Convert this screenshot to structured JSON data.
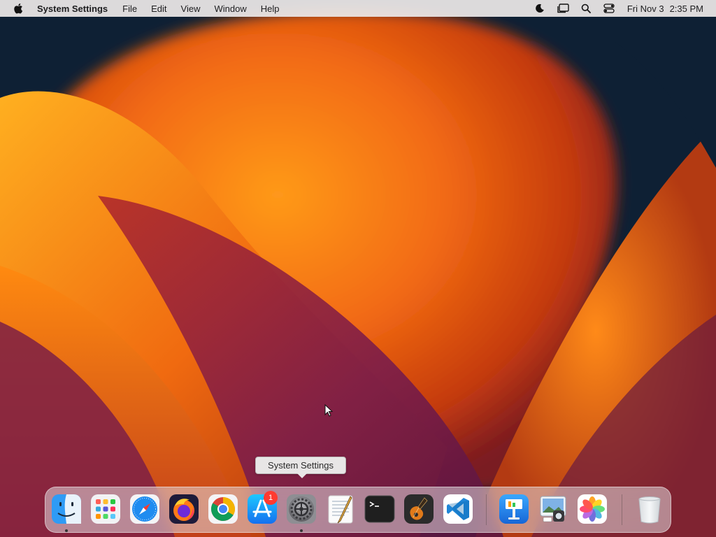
{
  "menubar": {
    "app_name": "System Settings",
    "menus": [
      "File",
      "Edit",
      "View",
      "Window",
      "Help"
    ],
    "status_icons": [
      "focus-moon-icon",
      "stage-manager-icon",
      "spotlight-search-icon",
      "control-center-icon"
    ],
    "clock_day": "Fri Nov 3",
    "clock_time": "2:35 PM"
  },
  "tooltip": {
    "text": "System Settings"
  },
  "dock": {
    "items": [
      {
        "name": "Finder",
        "icon": "finder-icon",
        "running": true
      },
      {
        "name": "Launchpad",
        "icon": "launchpad-icon",
        "running": false
      },
      {
        "name": "Safari",
        "icon": "safari-icon",
        "running": false
      },
      {
        "name": "Firefox",
        "icon": "firefox-icon",
        "running": false
      },
      {
        "name": "Chrome",
        "icon": "chrome-icon",
        "running": false
      },
      {
        "name": "App Store",
        "icon": "app-store-icon",
        "running": false
      },
      {
        "name": "System Settings",
        "icon": "system-settings-icon",
        "running": true,
        "badge": "1"
      },
      {
        "name": "TextEdit",
        "icon": "textedit-icon",
        "running": false
      },
      {
        "name": "Terminal",
        "icon": "terminal-icon",
        "running": false
      },
      {
        "name": "GarageBand",
        "icon": "garageband-icon",
        "running": false
      },
      {
        "name": "Visual Studio Code",
        "icon": "vscode-icon",
        "running": false
      },
      {
        "name": "Keynote",
        "icon": "keynote-icon",
        "running": false
      },
      {
        "name": "Preview",
        "icon": "preview-icon",
        "running": false
      },
      {
        "name": "Photos",
        "icon": "photos-icon",
        "running": false
      },
      {
        "name": "Trash",
        "icon": "trash-icon",
        "running": false
      }
    ],
    "badge": "1"
  },
  "colors": {
    "wallpaper_base": "#0f2235",
    "wallpaper_orange": "#f07a1a",
    "wallpaper_magenta": "#8a1f52",
    "badge_red": "#ff3b30"
  }
}
